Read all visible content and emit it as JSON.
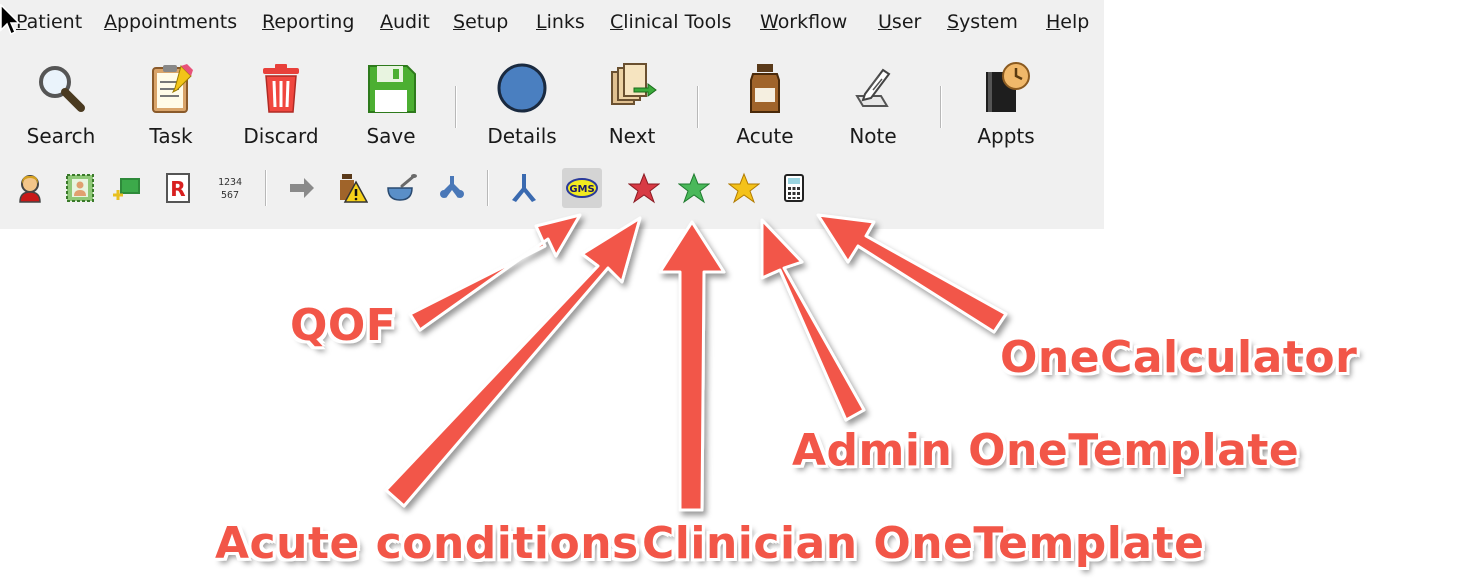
{
  "menu": [
    "Patient",
    "Appointments",
    "Reporting",
    "Audit",
    "Setup",
    "Links",
    "Clinical Tools",
    "Workflow",
    "User",
    "System",
    "Help"
  ],
  "toolbar_main": [
    {
      "label": "Search",
      "icon": "search-icon"
    },
    {
      "label": "Task",
      "icon": "task-clipboard-icon"
    },
    {
      "label": "Discard",
      "icon": "trash-icon"
    },
    {
      "label": "Save",
      "icon": "floppy-disk-icon"
    },
    {
      "label": "Details",
      "icon": "blue-circle-icon"
    },
    {
      "label": "Next",
      "icon": "next-documents-icon"
    },
    {
      "label": "Acute",
      "icon": "medicine-bottle-icon"
    },
    {
      "label": "Note",
      "icon": "note-pencil-icon"
    },
    {
      "label": "Appts",
      "icon": "appointments-book-clock-icon"
    }
  ],
  "toolbar_secondary_icons": [
    "patient-person-icon",
    "patient-card-icon",
    "new-item-icon",
    "repeat-prescription-icon",
    "numbers-keypad-icon",
    "forward-arrow-icon",
    "drug-warning-icon",
    "bowl-spoon-icon",
    "puzzle-link-icon",
    "y-fork-icon",
    "gms-qof-icon",
    "red-star-icon",
    "green-star-icon",
    "gold-star-icon",
    "calculator-icon"
  ],
  "gms_badge": "GMS",
  "annotations": {
    "qof": "QOF",
    "acute_conditions": "Acute conditions",
    "clinician_onetemplate": "Clinician OneTemplate",
    "admin_onetemplate": "Admin OneTemplate",
    "onecalculator": "OneCalculator"
  },
  "colors": {
    "annotation": "#f25648",
    "toolbar_bg": "#f0f0f0"
  }
}
